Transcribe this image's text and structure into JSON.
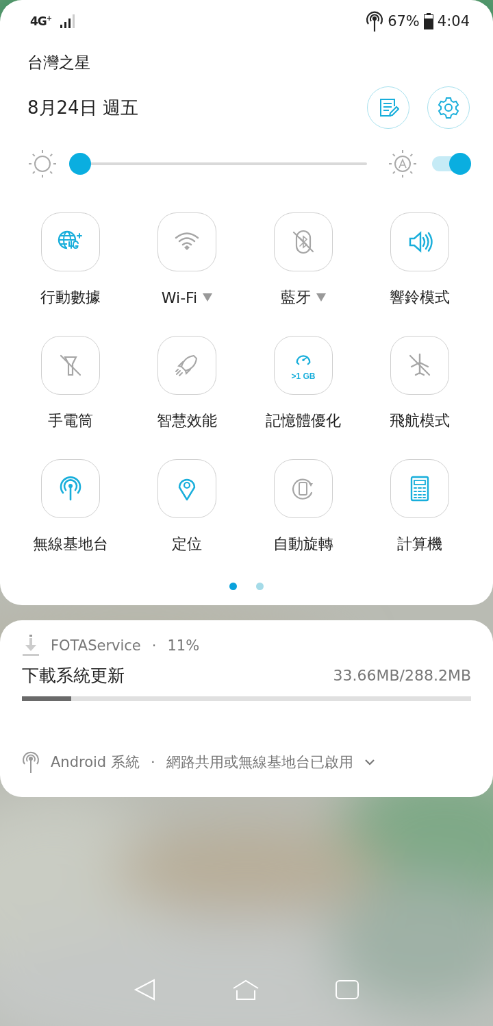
{
  "status_bar": {
    "network": "4G$^{+}$",
    "battery": "67%",
    "time": "4:04"
  },
  "header": {
    "carrier": "台灣之星",
    "date": "8月24日 週五"
  },
  "brightness": {
    "level": 0.03,
    "auto": true
  },
  "tiles": [
    {
      "label": "行動數據",
      "kind": "globe4g",
      "active": true,
      "dropdown": false
    },
    {
      "label": "Wi-Fi",
      "kind": "wifi",
      "active": false,
      "dropdown": true
    },
    {
      "label": "藍牙",
      "kind": "bluetooth",
      "active": false,
      "dropdown": true
    },
    {
      "label": "響鈴模式",
      "kind": "speaker",
      "active": true,
      "dropdown": false
    },
    {
      "label": "手電筒",
      "kind": "flashlight",
      "active": false,
      "dropdown": false
    },
    {
      "label": "智慧效能",
      "kind": "rocket",
      "active": false,
      "dropdown": false
    },
    {
      "label": "記憶體優化",
      "kind": "gauge",
      "active": true,
      "dropdown": false,
      "badge": ">1 GB"
    },
    {
      "label": "飛航模式",
      "kind": "plane",
      "active": false,
      "dropdown": false
    },
    {
      "label": "無線基地台",
      "kind": "hotspot",
      "active": true,
      "dropdown": false
    },
    {
      "label": "定位",
      "kind": "pin",
      "active": true,
      "dropdown": false
    },
    {
      "label": "自動旋轉",
      "kind": "rotate",
      "active": false,
      "dropdown": false
    },
    {
      "label": "計算機",
      "kind": "calculator",
      "active": true,
      "dropdown": false
    }
  ],
  "pages": [
    {
      "selected": true
    },
    {
      "selected": false
    }
  ],
  "notifications": [
    {
      "kind": "progress",
      "app": "FOTAService",
      "separator": "·",
      "extra": "11%",
      "title": "下載系統更新",
      "detail": "33.66MB/288.2MB",
      "level": 0.11
    },
    {
      "kind": "collapsed",
      "app": "Android 系統",
      "separator": "·",
      "extra": "網路共用或無線基地台已啟用",
      "expanded": false
    }
  ]
}
